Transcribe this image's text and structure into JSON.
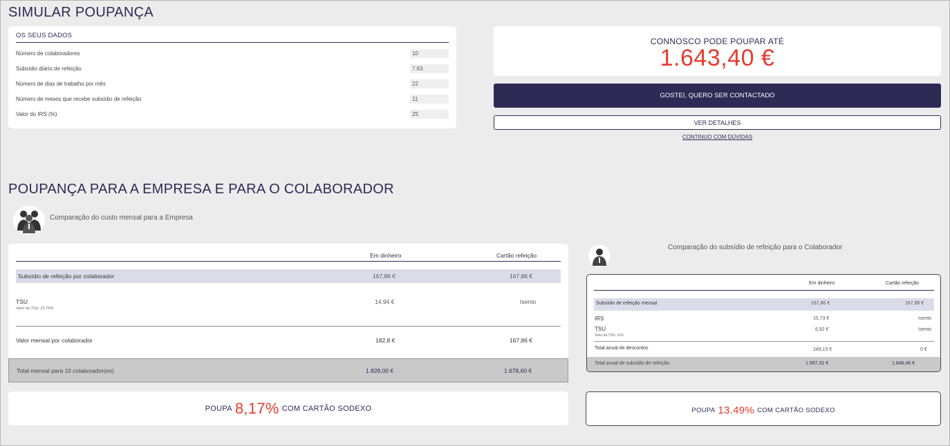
{
  "title": "SIMULAR POUPANÇA",
  "dados": {
    "header": "OS SEUS DADOS",
    "rows": [
      {
        "label": "Número de colaboradores",
        "value": "10"
      },
      {
        "label": "Subsídio diário de refeição",
        "value": "7.63"
      },
      {
        "label": "Número de dias de trabalho por mês",
        "value": "22"
      },
      {
        "label": "Número de meses que recebe subsídio de refeição",
        "value": "11"
      },
      {
        "label": "Valor do IRS (%)",
        "value": "25"
      }
    ]
  },
  "poupanca": {
    "label": "CONNOSCO PODE POUPAR ATÉ",
    "amount": "1.643,40 €"
  },
  "buttons": {
    "contact": "GOSTEI, QUERO SER CONTACTADO",
    "details": "VER DETALHES",
    "doubts": "CONTINUO COM DÚVIDAS"
  },
  "section2_title": "POUPANÇA PARA A EMPRESA E PARA O COLABORADOR",
  "empresa": {
    "label": "Comparação do custo mensal para a Empresa",
    "col_cash": "Em dinheiro",
    "col_card": "Cartão refeição",
    "rows": {
      "subsidio": {
        "label": "Subsídio de refeição por colaborador",
        "cash": "167,86 €",
        "card": "167,86 €"
      },
      "tsu": {
        "label": "TSU",
        "note": "Valor da TSU: 23,75%",
        "cash": "14,94 €",
        "card": "Isento"
      },
      "valor": {
        "label": "Valor mensal por colaborador",
        "cash": "182,8 €",
        "card": "167,86 €"
      },
      "total": {
        "label": "Total mensal para 10 colaborador(es)",
        "cash": "1.828,00 €",
        "card": "1.678,60 €"
      }
    },
    "savings_prefix": "POUPA",
    "savings_pct": "8,17%",
    "savings_suffix": "COM CARTÃO SODEXO"
  },
  "colaborador": {
    "label": "Comparação do subsídio de refeição para o Colaborador",
    "col_cash": "Em dinheiro",
    "col_card": "Cartão refeição",
    "rows": {
      "subsidio": {
        "label": "Subsídio de refeição mensal",
        "cash": "167,86 €",
        "card": "167,86 €"
      },
      "irs": {
        "label": "IRS",
        "cash": "15,73 €",
        "card": "Isento"
      },
      "tsu": {
        "label": "TSU",
        "note": "Valor da TSU: 11%",
        "cash": "6,92 €",
        "card": "Isento"
      },
      "descontos": {
        "label": "Total anual de descontos",
        "cash": "249,15 €",
        "card": "0 €"
      },
      "total": {
        "label": "Total anual de subsídio de refeição",
        "cash": "1.597,31 €",
        "card": "1.846,46 €"
      }
    },
    "savings_prefix": "POUPA",
    "savings_pct": "13.49%",
    "savings_suffix": "COM CARTÃO SODEXO"
  },
  "colors": {
    "navy": "#2d2a55",
    "red": "#e63b2e",
    "shade": "#dcdce8",
    "total_bg": "#c9c9c9"
  }
}
